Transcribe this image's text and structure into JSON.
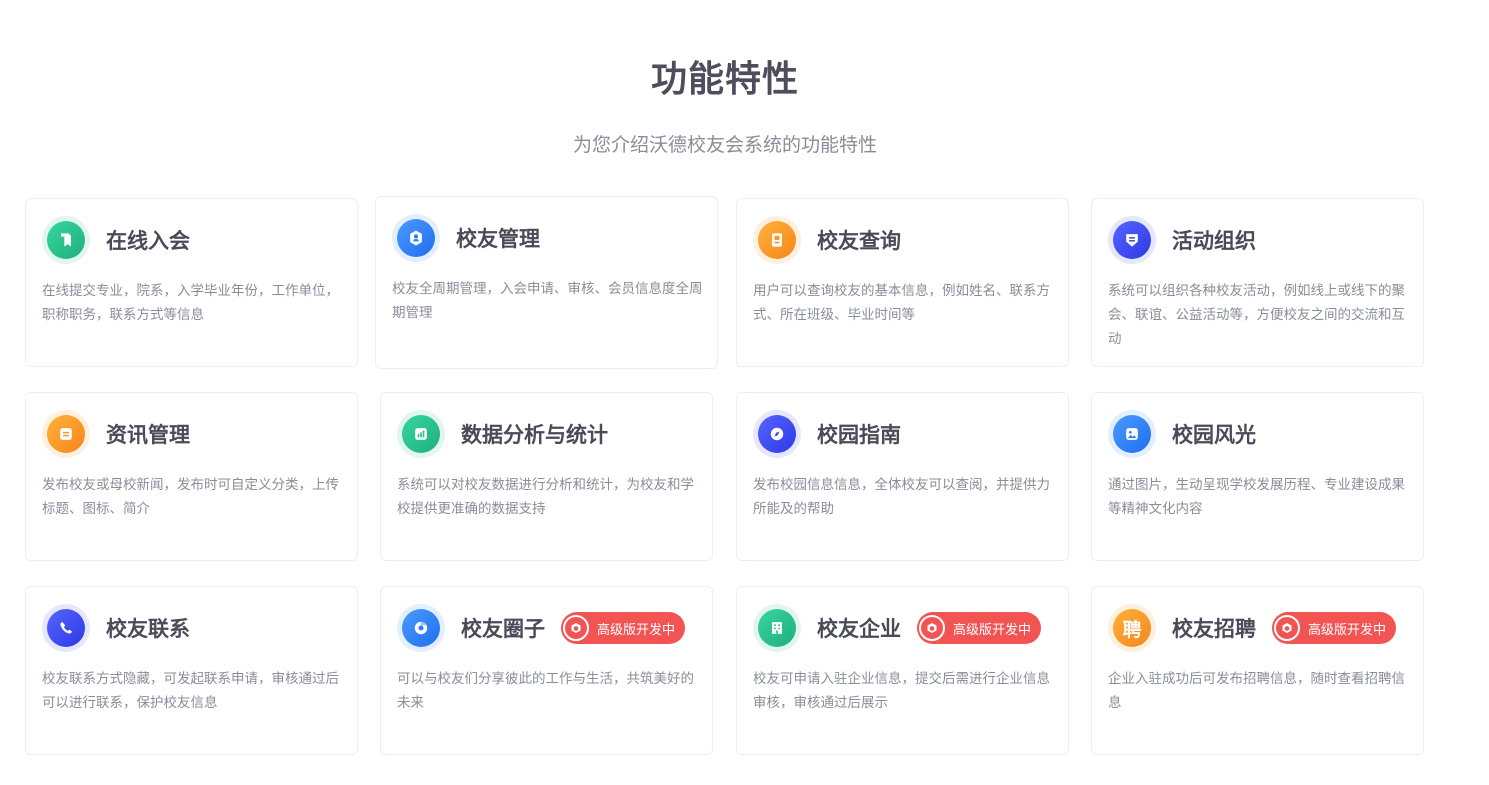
{
  "header": {
    "title": "功能特性",
    "subtitle": "为您介绍沃德校友会系统的功能特性"
  },
  "badge_label": "高级版开发中",
  "colors": {
    "green": "#2cc08e",
    "blue": "#2a7cf6",
    "orange": "#f79a25",
    "indigo": "#3b47f0",
    "badge": "#f25454"
  },
  "features": [
    {
      "title": "在线入会",
      "icon": "bookmark-icon",
      "color": "green",
      "desc": "在线提交专业，院系，入学毕业年份，工作单位，职称职务，联系方式等信息"
    },
    {
      "title": "校友管理",
      "icon": "user-hexagon-icon",
      "color": "blue",
      "desc": "校友全周期管理，入会申请、审核、会员信息度全周期管理"
    },
    {
      "title": "校友查询",
      "icon": "contact-card-icon",
      "color": "orange",
      "desc": "用户可以查询校友的基本信息，例如姓名、联系方式、所在班级、毕业时间等"
    },
    {
      "title": "活动组织",
      "icon": "activity-shield-icon",
      "color": "indigo",
      "desc": "系统可以组织各种校友活动，例如线上或线下的聚会、联谊、公益活动等，方便校友之间的交流和互动"
    },
    {
      "title": "资讯管理",
      "icon": "news-icon",
      "color": "orange",
      "desc": "发布校友或母校新闻，发布时可自定义分类，上传标题、图标、简介"
    },
    {
      "title": "数据分析与统计",
      "icon": "chart-icon",
      "color": "green",
      "desc": "系统可以对校友数据进行分析和统计，为校友和学校提供更准确的数据支持"
    },
    {
      "title": "校园指南",
      "icon": "compass-icon",
      "color": "indigo",
      "desc": "发布校园信息信息，全体校友可以查阅，并提供力所能及的帮助"
    },
    {
      "title": "校园风光",
      "icon": "image-icon",
      "color": "blue",
      "desc": "通过图片，生动呈现学校发展历程、专业建设成果等精神文化内容"
    },
    {
      "title": "校友联系",
      "icon": "phone-icon",
      "color": "indigo",
      "desc": "校友联系方式隐藏，可发起联系申请，审核通过后可以进行联系，保护校友信息"
    },
    {
      "title": "校友圈子",
      "icon": "circle-icon",
      "color": "blue",
      "desc": "可以与校友们分享彼此的工作与生活，共筑美好的未来",
      "badge": true
    },
    {
      "title": "校友企业",
      "icon": "building-icon",
      "color": "green",
      "desc": "校友可申请入驻企业信息，提交后需进行企业信息审核，审核通过后展示",
      "badge": true
    },
    {
      "title": "校友招聘",
      "icon": "recruit-icon",
      "color": "orange",
      "desc": "企业入驻成功后可发布招聘信息，随时查看招聘信息",
      "badge": true,
      "icon_text": "聘"
    }
  ]
}
